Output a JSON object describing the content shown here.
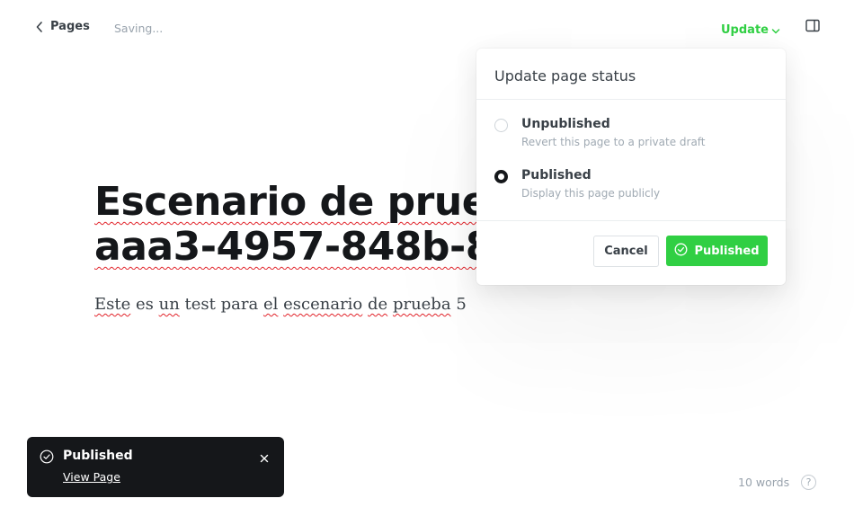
{
  "header": {
    "back_label": "Pages",
    "status_text": "Saving...",
    "update_label": "Update"
  },
  "editor": {
    "title_line1": "Escenario de prueba",
    "title_line2": "aaa3-4957-848b-853",
    "body_words": [
      "Este",
      "es",
      "un",
      "test",
      "para",
      "el",
      "escenario",
      "de",
      "prueba",
      "5"
    ]
  },
  "popover": {
    "title": "Update page status",
    "options": [
      {
        "label": "Unpublished",
        "description": "Revert this page to a private draft",
        "selected": false
      },
      {
        "label": "Published",
        "description": "Display this page publicly",
        "selected": true
      }
    ],
    "cancel_label": "Cancel",
    "confirm_label": "Published"
  },
  "toast": {
    "title": "Published",
    "link_label": "View Page"
  },
  "footer": {
    "word_count": "10 words",
    "help_label": "?"
  },
  "colors": {
    "accent_green": "#30cf43",
    "dark": "#15171a",
    "muted": "#99a3ad",
    "spell_error": "#e2242b"
  },
  "icons": {
    "back": "chevron-left-icon",
    "update_caret": "chevron-down-icon",
    "settings": "sidebar-panel-icon",
    "published": "check-circle-icon",
    "toast_status": "check-circle-icon",
    "toast_close": "close-icon",
    "help": "question-circle-icon"
  }
}
